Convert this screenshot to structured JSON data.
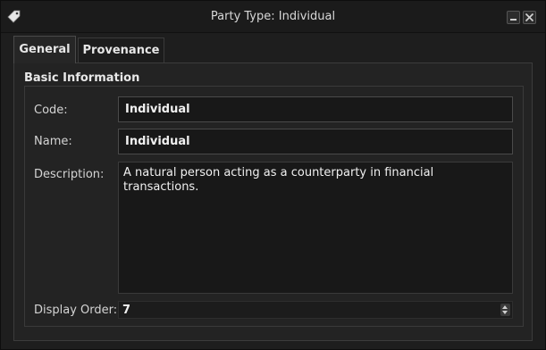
{
  "window": {
    "title": "Party Type: Individual"
  },
  "tabs": [
    {
      "label": "General",
      "active": true
    },
    {
      "label": "Provenance",
      "active": false
    }
  ],
  "section": {
    "title": "Basic Information"
  },
  "form": {
    "code": {
      "label": "Code:",
      "value": "Individual"
    },
    "name": {
      "label": "Name:",
      "value": "Individual"
    },
    "description": {
      "label": "Description:",
      "value": "A natural person acting as a counterparty in financial transactions."
    },
    "display_order": {
      "label": "Display Order:",
      "value": "7"
    }
  },
  "icons": {
    "app": "tag-icon",
    "minimize": "minimize-icon",
    "close": "close-icon",
    "spinner": "spin-arrows-icon"
  },
  "colors": {
    "background": "#1e1e1e",
    "field_background": "#181818",
    "border": "#4a4a4a",
    "text": "#dcdcdc"
  }
}
